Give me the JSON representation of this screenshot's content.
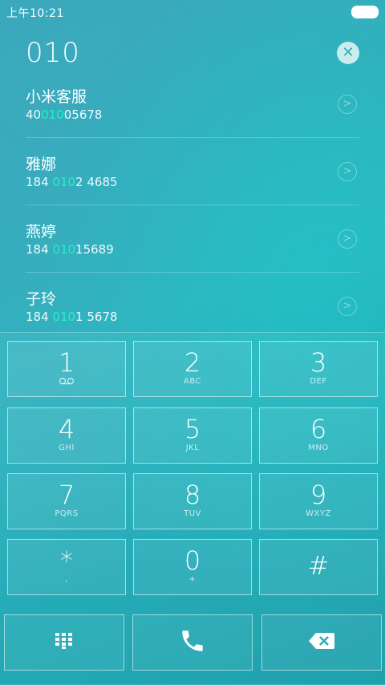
{
  "status_bar": {
    "time": "上午10:21"
  },
  "dialer": {
    "number": "010",
    "clear_icon": "clear-icon"
  },
  "contacts": [
    {
      "name": "小米客服",
      "number_before": "40",
      "number_match": "010",
      "number_after": "05678"
    },
    {
      "name": "雅娜",
      "number_before": "184 ",
      "number_match": "010",
      "number_after": "2 4685"
    },
    {
      "name": "燕婷",
      "number_before": "184 ",
      "number_match": "010",
      "number_after": "15689"
    },
    {
      "name": "子玲",
      "number_before": "184 ",
      "number_match": "010",
      "number_after": "1 5678"
    }
  ],
  "keypad": {
    "keys": [
      {
        "digit": "1",
        "letters": ""
      },
      {
        "digit": "2",
        "letters": "ABC"
      },
      {
        "digit": "3",
        "letters": "DEF"
      },
      {
        "digit": "4",
        "letters": "GHI"
      },
      {
        "digit": "5",
        "letters": "JKL"
      },
      {
        "digit": "6",
        "letters": "MNO"
      },
      {
        "digit": "7",
        "letters": "PQRS"
      },
      {
        "digit": "8",
        "letters": "TUV"
      },
      {
        "digit": "9",
        "letters": "WXYZ"
      },
      {
        "digit": "*",
        "letters": ","
      },
      {
        "digit": "0",
        "letters": "+"
      },
      {
        "digit": "#",
        "letters": ""
      }
    ],
    "voicemail_icon": "voicemail-icon"
  },
  "actions": {
    "keypad_toggle_icon": "keypad-icon",
    "call_icon": "phone-icon",
    "backspace_icon": "backspace-icon"
  },
  "colors": {
    "match_highlight": "#25f0c8",
    "accent": "#36a9b7"
  }
}
